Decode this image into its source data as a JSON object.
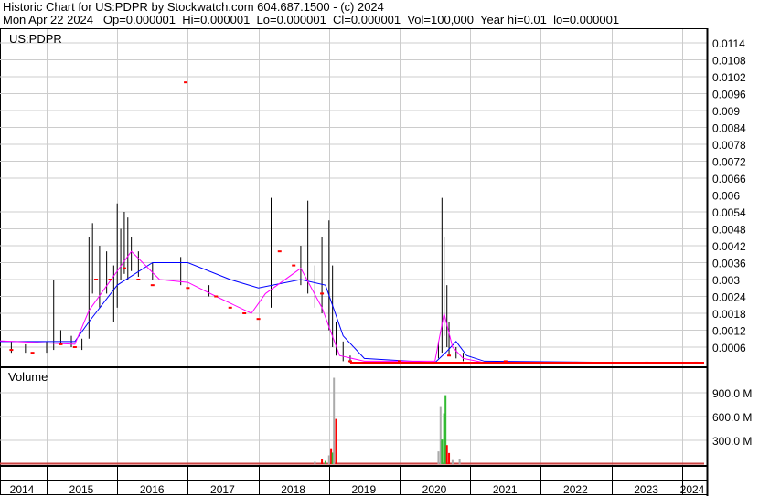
{
  "header": {
    "line1": "Historic Chart for US:PDPR by Stockwatch.com 604.687.1500 - (c) 2024",
    "line2": "Mon Apr 22 2024   Op=0.000001  Hi=0.000001  Lo=0.000001  Cl=0.000001  Vol=100,000  Year hi=0.01  lo=0.000001"
  },
  "chart_data": [
    {
      "type": "line",
      "title": "US:PDPR",
      "ylim": [
        0,
        0.0117
      ],
      "yticks": [
        "0.0114",
        "0.0108",
        "0.0102",
        "0.0096",
        "0.009",
        "0.0084",
        "0.0078",
        "0.0072",
        "0.0066",
        "0.006",
        "0.0054",
        "0.0048",
        "0.0042",
        "0.0036",
        "0.003",
        "0.0024",
        "0.0018",
        "0.0012",
        "0.0006"
      ],
      "xlabels": [
        "2014",
        "2015",
        "2016",
        "2017",
        "2018",
        "2019",
        "2020",
        "2021",
        "2022",
        "2023",
        "2024"
      ],
      "colors": {
        "bars": "#000000",
        "close": "#ff0000",
        "ma_long": "#0000ff",
        "ma_short": "#ff00ff"
      },
      "bars": [
        [
          2014.0,
          0.0005,
          0.0015
        ],
        [
          2014.1,
          0.0006,
          0.0012
        ],
        [
          2014.3,
          0.0005,
          0.0009
        ],
        [
          2014.5,
          0.0004,
          0.0008
        ],
        [
          2014.7,
          0.0004,
          0.0007
        ],
        [
          2015.0,
          0.0004,
          0.0008
        ],
        [
          2015.1,
          0.0005,
          0.003
        ],
        [
          2015.2,
          0.0007,
          0.0012
        ],
        [
          2015.35,
          0.0006,
          0.001
        ],
        [
          2015.5,
          0.0005,
          0.0009
        ],
        [
          2015.6,
          0.0009,
          0.0045
        ],
        [
          2015.65,
          0.0025,
          0.005
        ],
        [
          2015.75,
          0.002,
          0.0042
        ],
        [
          2015.85,
          0.0025,
          0.004
        ],
        [
          2015.95,
          0.0015,
          0.0035
        ],
        [
          2016.0,
          0.002,
          0.0057
        ],
        [
          2016.05,
          0.003,
          0.0048
        ],
        [
          2016.1,
          0.0032,
          0.0054
        ],
        [
          2016.15,
          0.003,
          0.0052
        ],
        [
          2016.2,
          0.0033,
          0.0045
        ],
        [
          2016.3,
          0.0031,
          0.004
        ],
        [
          2016.5,
          0.003,
          0.0036
        ],
        [
          2016.9,
          0.0028,
          0.0038
        ],
        [
          2017.3,
          0.0024,
          0.0028
        ],
        [
          2018.18,
          0.002,
          0.0059
        ],
        [
          2018.6,
          0.0028,
          0.0042
        ],
        [
          2018.7,
          0.0025,
          0.0058
        ],
        [
          2018.8,
          0.002,
          0.0035
        ],
        [
          2018.9,
          0.0018,
          0.0045
        ],
        [
          2019.0,
          0.0012,
          0.0051
        ],
        [
          2019.05,
          0.0006,
          0.0035
        ],
        [
          2019.1,
          0.0003,
          0.0015
        ],
        [
          2019.2,
          0.0001,
          0.0008
        ],
        [
          2019.3,
          5e-05,
          0.0003
        ],
        [
          2020.55,
          0.0002,
          0.0008
        ],
        [
          2020.6,
          0.0004,
          0.0059
        ],
        [
          2020.63,
          0.001,
          0.0045
        ],
        [
          2020.67,
          0.0006,
          0.0028
        ],
        [
          2020.7,
          0.0003,
          0.0015
        ],
        [
          2020.8,
          0.0002,
          0.0006
        ],
        [
          2020.9,
          0.0001,
          0.0004
        ]
      ],
      "close": [
        [
          2014.0,
          0.0008
        ],
        [
          2014.2,
          0.0006
        ],
        [
          2014.5,
          0.0005
        ],
        [
          2014.8,
          0.0004
        ],
        [
          2015.2,
          0.0007
        ],
        [
          2015.4,
          0.0006
        ],
        [
          2015.7,
          0.003
        ],
        [
          2015.9,
          0.003
        ],
        [
          2016.1,
          0.0034
        ],
        [
          2016.3,
          0.003
        ],
        [
          2016.5,
          0.0028
        ],
        [
          2016.97,
          0.01
        ],
        [
          2017.0,
          0.0027
        ],
        [
          2017.4,
          0.0024
        ],
        [
          2017.6,
          0.002
        ],
        [
          2017.8,
          0.0018
        ],
        [
          2018.0,
          0.0016
        ],
        [
          2018.3,
          0.004
        ],
        [
          2018.5,
          0.0035
        ],
        [
          2018.9,
          0.0025
        ],
        [
          2019.3,
          0.0001
        ],
        [
          2020.0,
          0.0001
        ],
        [
          2020.7,
          0.0003
        ],
        [
          2021.5,
          0.0001
        ],
        [
          2022.5,
          5e-05
        ],
        [
          2023.5,
          5e-05
        ],
        [
          2024.2,
          5e-05
        ]
      ],
      "ma_long": [
        [
          2013.7,
          0.0008
        ],
        [
          2015.4,
          0.0008
        ],
        [
          2015.6,
          0.0015
        ],
        [
          2016.0,
          0.0028
        ],
        [
          2016.5,
          0.0036
        ],
        [
          2017.0,
          0.0036
        ],
        [
          2017.6,
          0.003
        ],
        [
          2018.0,
          0.0027
        ],
        [
          2018.6,
          0.003
        ],
        [
          2018.95,
          0.0028
        ],
        [
          2019.2,
          0.001
        ],
        [
          2019.5,
          0.0002
        ],
        [
          2020.5,
          5e-05
        ],
        [
          2020.65,
          0.0004
        ],
        [
          2020.8,
          0.0008
        ],
        [
          2020.95,
          0.0003
        ],
        [
          2021.2,
          0.0001
        ],
        [
          2024.3,
          3e-05
        ]
      ],
      "ma_short": [
        [
          2013.7,
          0.0009
        ],
        [
          2015.4,
          0.0007
        ],
        [
          2015.6,
          0.0019
        ],
        [
          2016.0,
          0.0033
        ],
        [
          2016.2,
          0.004
        ],
        [
          2016.6,
          0.003
        ],
        [
          2017.0,
          0.0029
        ],
        [
          2017.4,
          0.0024
        ],
        [
          2017.9,
          0.0018
        ],
        [
          2018.1,
          0.0025
        ],
        [
          2018.6,
          0.0034
        ],
        [
          2018.9,
          0.002
        ],
        [
          2019.15,
          0.0003
        ],
        [
          2019.5,
          0.0001
        ],
        [
          2020.5,
          0.0001
        ],
        [
          2020.63,
          0.0018
        ],
        [
          2020.75,
          0.0006
        ],
        [
          2020.9,
          0.0002
        ],
        [
          2021.2,
          5e-05
        ],
        [
          2024.3,
          3e-05
        ]
      ]
    },
    {
      "type": "bar",
      "title": "Volume",
      "ylim": [
        0,
        1140
      ],
      "yticks": [
        "900.0 M",
        "600.0 M",
        "300.0 M"
      ],
      "ytick_values": [
        900,
        600,
        300
      ],
      "colors": {
        "up": "#33bb33",
        "down": "#ff0000",
        "flat": "#aaaaaa"
      },
      "values": [
        [
          2018.9,
          60,
          "down"
        ],
        [
          2018.95,
          40,
          "up"
        ],
        [
          2019.0,
          110,
          "flat"
        ],
        [
          2019.03,
          200,
          "down"
        ],
        [
          2019.05,
          145,
          "up"
        ],
        [
          2019.07,
          1090,
          "flat"
        ],
        [
          2019.1,
          570,
          "down"
        ],
        [
          2018.8,
          30,
          "flat"
        ],
        [
          2020.55,
          160,
          "flat"
        ],
        [
          2020.58,
          720,
          "flat"
        ],
        [
          2020.6,
          310,
          "up"
        ],
        [
          2020.63,
          640,
          "up"
        ],
        [
          2020.65,
          870,
          "up"
        ],
        [
          2020.67,
          240,
          "down"
        ],
        [
          2020.7,
          140,
          "down"
        ],
        [
          2020.75,
          50,
          "flat"
        ],
        [
          2020.85,
          60,
          "flat"
        ]
      ]
    }
  ]
}
